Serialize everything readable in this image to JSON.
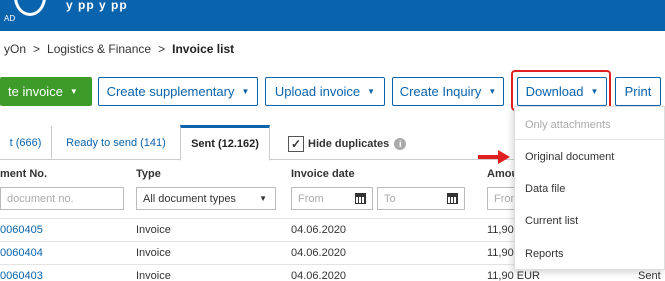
{
  "header": {
    "logo_text": "AD",
    "menu_text": "y                 pp   y           pp"
  },
  "breadcrumb": {
    "root": "yOn",
    "sep": ">",
    "section": "Logistics & Finance",
    "current": "Invoice list"
  },
  "toolbar": {
    "create_label": "te invoice",
    "supplementary_label": "Create supplementary",
    "upload_label": "Upload invoice",
    "inquiry_label": "Create Inquiry",
    "download_label": "Download",
    "print_label": "Print",
    "caret": "▼"
  },
  "tabs": [
    {
      "label": "t (666)"
    },
    {
      "label": "Ready to send (141)"
    },
    {
      "label": "Sent (12.162)"
    }
  ],
  "hide_duplicates": {
    "label": "Hide duplicates",
    "checked": true,
    "check_glyph": "✓"
  },
  "columns": [
    "ment No.",
    "Type",
    "Invoice date",
    "Amou"
  ],
  "filters": {
    "number_placeholder": "document no.",
    "type_value": "All document types",
    "from_placeholder": "From",
    "to_placeholder": "To",
    "amount_placeholder": "From"
  },
  "rows": [
    {
      "number": "0060405",
      "type": "Invoice",
      "date": "04.06.2020",
      "amount": "11,90",
      "status": ""
    },
    {
      "number": "0060404",
      "type": "Invoice",
      "date": "04.06.2020",
      "amount": "11,90",
      "status": ""
    },
    {
      "number": "0060403",
      "type": "Invoice",
      "date": "04.06.2020",
      "amount": "11,90 EUR",
      "status": "Sent"
    }
  ],
  "download_menu": {
    "items": [
      {
        "label": "Only attachments",
        "disabled": true
      },
      {
        "label": "Original document",
        "disabled": false
      },
      {
        "label": "Data file",
        "disabled": false
      },
      {
        "label": "Current list",
        "disabled": false
      },
      {
        "label": "Reports",
        "disabled": false
      }
    ]
  },
  "colors": {
    "brand_blue": "#0a63ad",
    "create_green": "#3d9b2a",
    "annotation_red": "#e02020"
  }
}
